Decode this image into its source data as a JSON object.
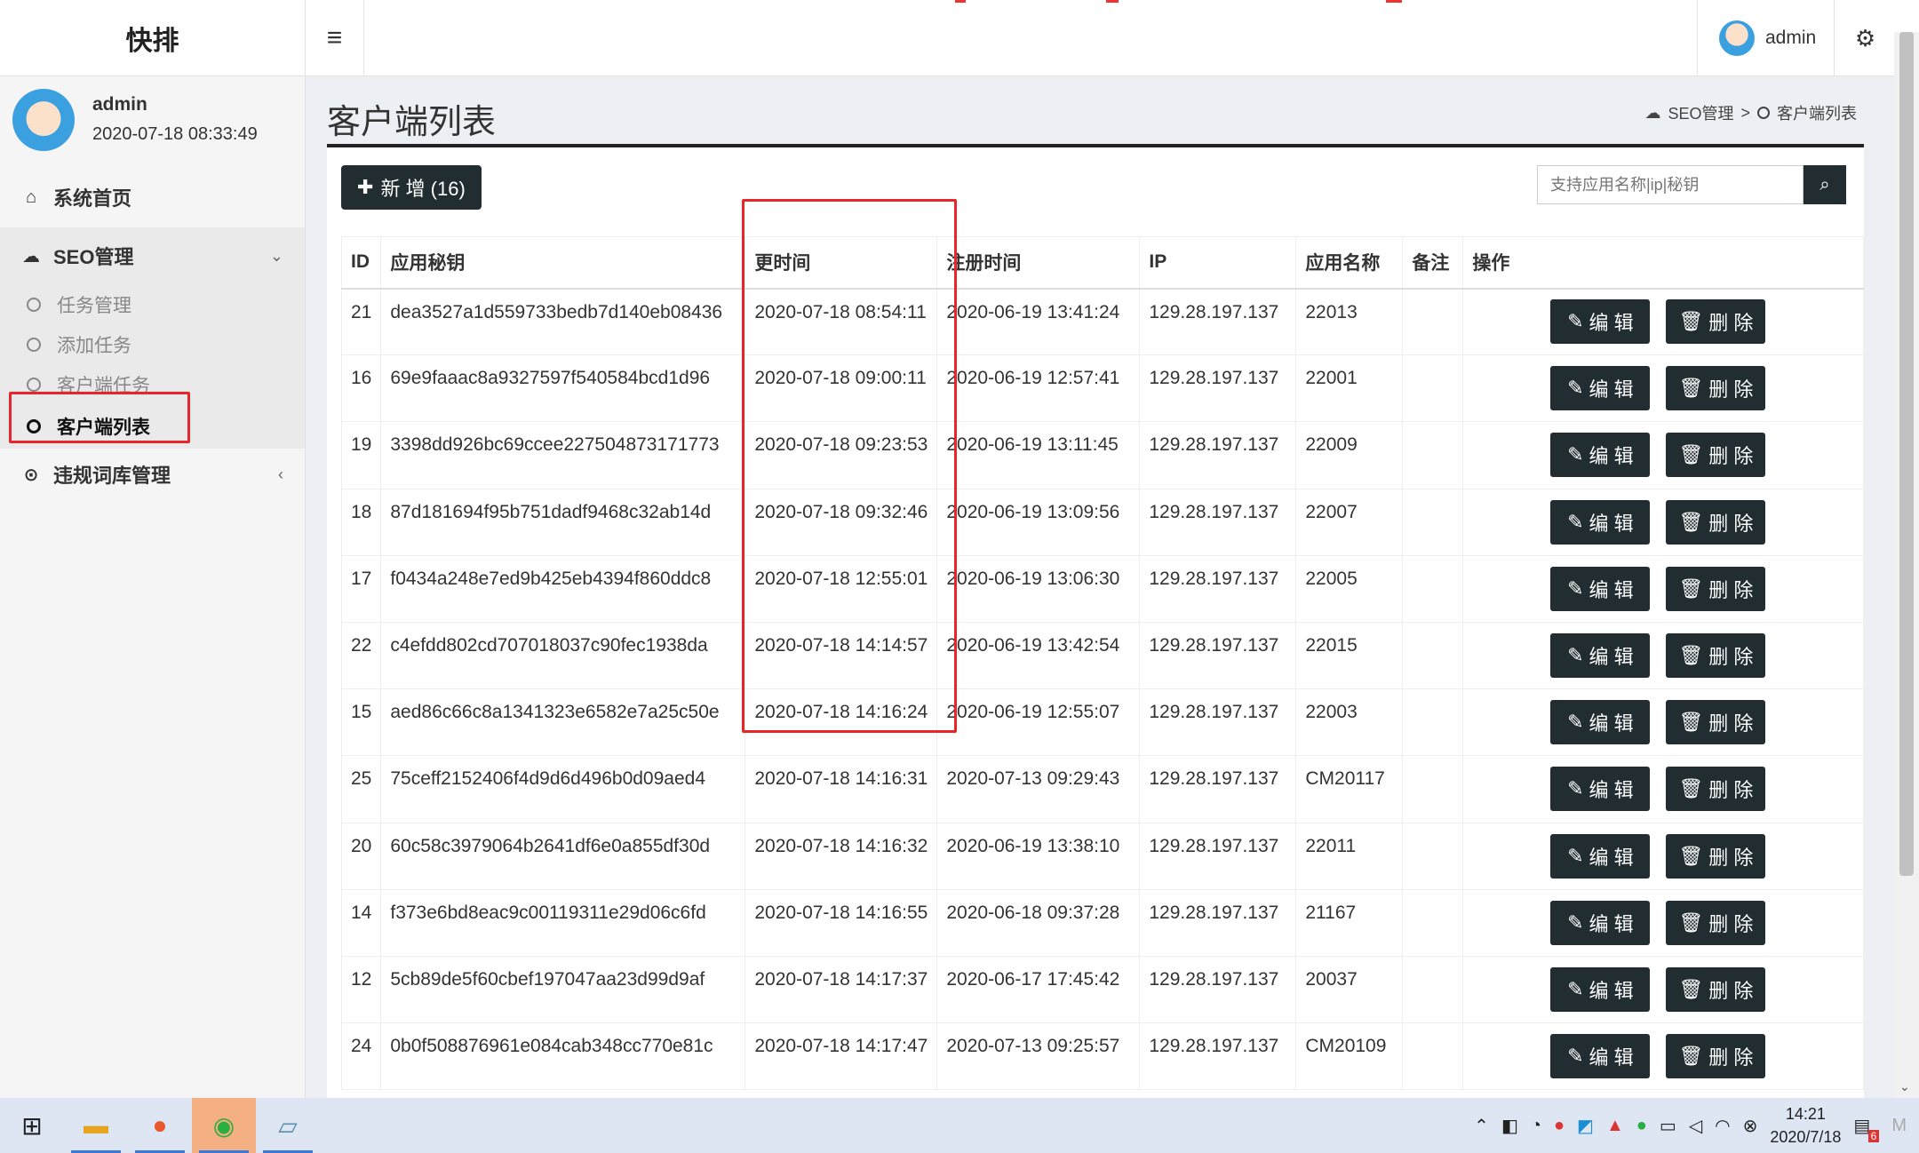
{
  "header": {
    "logo": "快排",
    "menu_icon": "hamburger-icon",
    "user": "admin"
  },
  "sidebar": {
    "user_name": "admin",
    "user_time": "2020-07-18 08:33:49",
    "home": "系统首页",
    "seo_group": "SEO管理",
    "sub_items": [
      "任务管理",
      "添加任务",
      "客户端任务",
      "客户端列表"
    ],
    "violation": "违规词库管理"
  },
  "page": {
    "title": "客户端列表",
    "breadcrumb_parent": "SEO管理",
    "breadcrumb_sep": ">",
    "breadcrumb_current": "客户端列表",
    "add_button": "新 增 (16)",
    "search_placeholder": "支持应用名称|ip|秘钥"
  },
  "table": {
    "headers": [
      "ID",
      "应用秘钥",
      "更时间",
      "注册时间",
      "IP",
      "应用名称",
      "备注",
      "操作"
    ],
    "edit_label": "编 辑",
    "delete_label": "删 除",
    "rows": [
      [
        "21",
        "dea3527a1d559733bedb7d140eb08436",
        "2020-07-18 08:54:11",
        "2020-06-19 13:41:24",
        "129.28.197.137",
        "22013",
        ""
      ],
      [
        "16",
        "69e9faaac8a9327597f540584bcd1d96",
        "2020-07-18 09:00:11",
        "2020-06-19 12:57:41",
        "129.28.197.137",
        "22001",
        ""
      ],
      [
        "19",
        "3398dd926bc69ccee227504873171773",
        "2020-07-18 09:23:53",
        "2020-06-19 13:11:45",
        "129.28.197.137",
        "22009",
        ""
      ],
      [
        "18",
        "87d181694f95b751dadf9468c32ab14d",
        "2020-07-18 09:32:46",
        "2020-06-19 13:09:56",
        "129.28.197.137",
        "22007",
        ""
      ],
      [
        "17",
        "f0434a248e7ed9b425eb4394f860ddc8",
        "2020-07-18 12:55:01",
        "2020-06-19 13:06:30",
        "129.28.197.137",
        "22005",
        ""
      ],
      [
        "22",
        "c4efdd802cd707018037c90fec1938da",
        "2020-07-18 14:14:57",
        "2020-06-19 13:42:54",
        "129.28.197.137",
        "22015",
        ""
      ],
      [
        "15",
        "aed86c66c8a1341323e6582e7a25c50e",
        "2020-07-18 14:16:24",
        "2020-06-19 12:55:07",
        "129.28.197.137",
        "22003",
        ""
      ],
      [
        "25",
        "75ceff2152406f4d9d6d496b0d09aed4",
        "2020-07-18 14:16:31",
        "2020-07-13 09:29:43",
        "129.28.197.137",
        "CM20117",
        ""
      ],
      [
        "20",
        "60c58c3979064b2641df6e0a855df30d",
        "2020-07-18 14:16:32",
        "2020-06-19 13:38:10",
        "129.28.197.137",
        "22011",
        ""
      ],
      [
        "14",
        "f373e6bd8eac9c00119311e29d06c6fd",
        "2020-07-18 14:16:55",
        "2020-06-18 09:37:28",
        "129.28.197.137",
        "21167",
        ""
      ],
      [
        "12",
        "5cb89de5f60cbef197047aa23d99d9af",
        "2020-07-18 14:17:37",
        "2020-06-17 17:45:42",
        "129.28.197.137",
        "20037",
        ""
      ],
      [
        "24",
        "0b0f508876961e084cab348cc770e81c",
        "2020-07-18 14:17:47",
        "2020-07-13 09:25:57",
        "129.28.197.137",
        "CM20109",
        ""
      ]
    ]
  },
  "taskbar": {
    "time": "14:21",
    "date": "2020/7/18",
    "notif_count": "6"
  },
  "colors": {
    "accent": "#222d32",
    "highlight": "#e8252a"
  }
}
